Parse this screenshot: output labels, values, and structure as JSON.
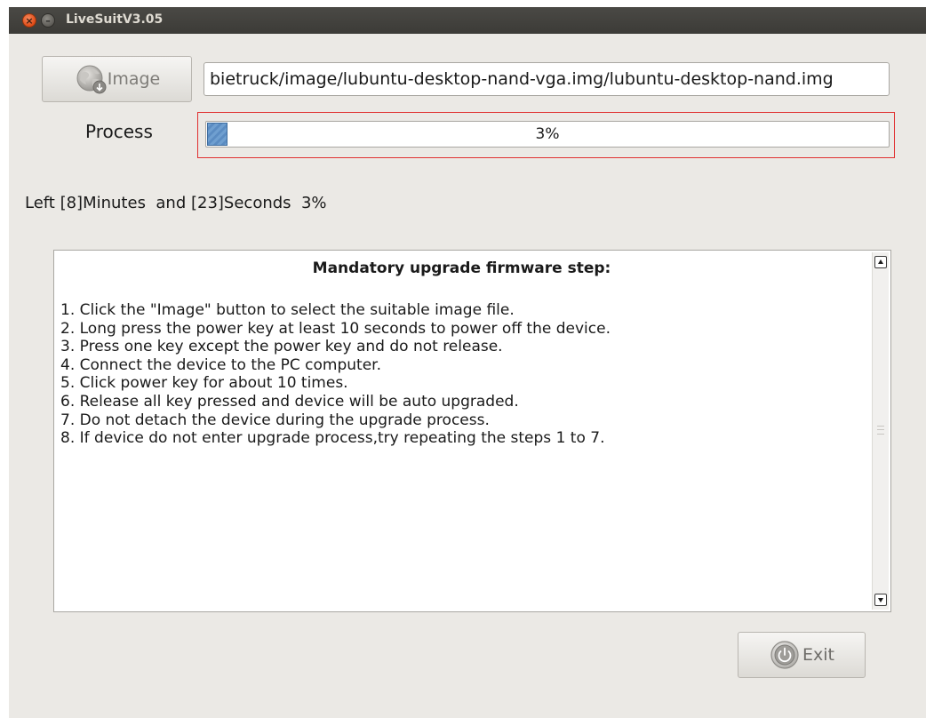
{
  "window": {
    "title": "LiveSuitV3.05",
    "close_glyph": "×",
    "minimize_glyph": "–"
  },
  "image_picker": {
    "button_label": "Image",
    "button_icon": "globe-icon",
    "path_value": "bietruck/image/lubuntu-desktop-nand-vga.img/lubuntu-desktop-nand.img"
  },
  "process": {
    "label": "Process",
    "percent_text": "3%",
    "fraction": 0.03
  },
  "status": {
    "text": "Left [8]Minutes  and [23]Seconds  3%"
  },
  "instructions": {
    "heading": "Mandatory upgrade firmware step:",
    "steps": [
      "1. Click the \"Image\" button to select the suitable image file.",
      "2. Long press the power key at least 10 seconds to power off the device.",
      "3. Press one key except the power key and do not release.",
      "4. Connect the device to the PC computer.",
      "5. Click power key for about 10 times.",
      "6. Release all key pressed and device will be auto upgraded.",
      "7. Do not detach the device during the upgrade process.",
      "8. If device do not enter upgrade process,try repeating the steps 1 to 7."
    ]
  },
  "footer": {
    "exit_label": "Exit",
    "exit_icon": "power-icon"
  },
  "colors": {
    "titlebar": "#3c3b37",
    "window_bg": "#ebe9e5",
    "close_button": "#df4a16",
    "highlight_frame": "#e03030",
    "progress_fill": "#6f9fd0"
  }
}
